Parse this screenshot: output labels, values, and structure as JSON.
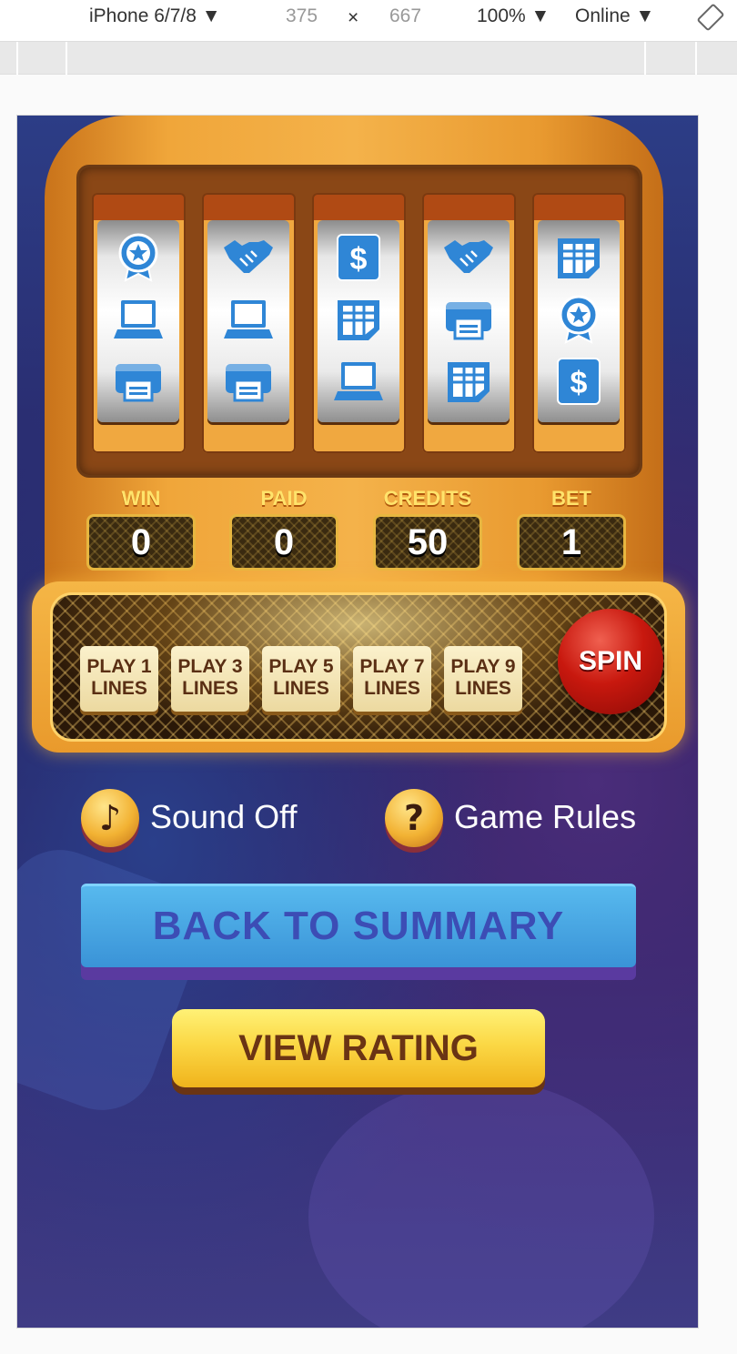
{
  "devtools": {
    "device": "iPhone 6/7/8",
    "width": "375",
    "times": "×",
    "height": "667",
    "zoom": "100%",
    "network": "Online"
  },
  "reels": [
    [
      "badge-icon",
      "laptop-icon",
      "printer-icon"
    ],
    [
      "handshake-icon",
      "laptop-icon",
      "printer-icon"
    ],
    [
      "dollar-icon",
      "spreadsheet-icon",
      "laptop-icon"
    ],
    [
      "handshake-icon",
      "printer-icon",
      "spreadsheet-icon"
    ],
    [
      "spreadsheet-icon",
      "badge-icon",
      "dollar-icon"
    ]
  ],
  "stats": {
    "win": {
      "label": "WIN",
      "value": "0"
    },
    "paid": {
      "label": "PAID",
      "value": "0"
    },
    "credits": {
      "label": "CREDITS",
      "value": "50"
    },
    "bet": {
      "label": "BET",
      "value": "1"
    }
  },
  "lines": [
    {
      "l1": "PLAY 1",
      "l2": "LINES"
    },
    {
      "l1": "PLAY 3",
      "l2": "LINES"
    },
    {
      "l1": "PLAY 5",
      "l2": "LINES"
    },
    {
      "l1": "PLAY 7",
      "l2": "LINES"
    },
    {
      "l1": "PLAY 9",
      "l2": "LINES"
    }
  ],
  "spin_label": "SPIN",
  "options": {
    "sound_label": "Sound Off",
    "rules_label": "Game Rules",
    "rules_glyph": "?"
  },
  "buttons": {
    "back": "BACK TO SUMMARY",
    "rating": "VIEW RATING"
  },
  "colors": {
    "icon_blue": "#2f86d6",
    "gold": "#f0a63a",
    "spin_red": "#c8180e"
  }
}
